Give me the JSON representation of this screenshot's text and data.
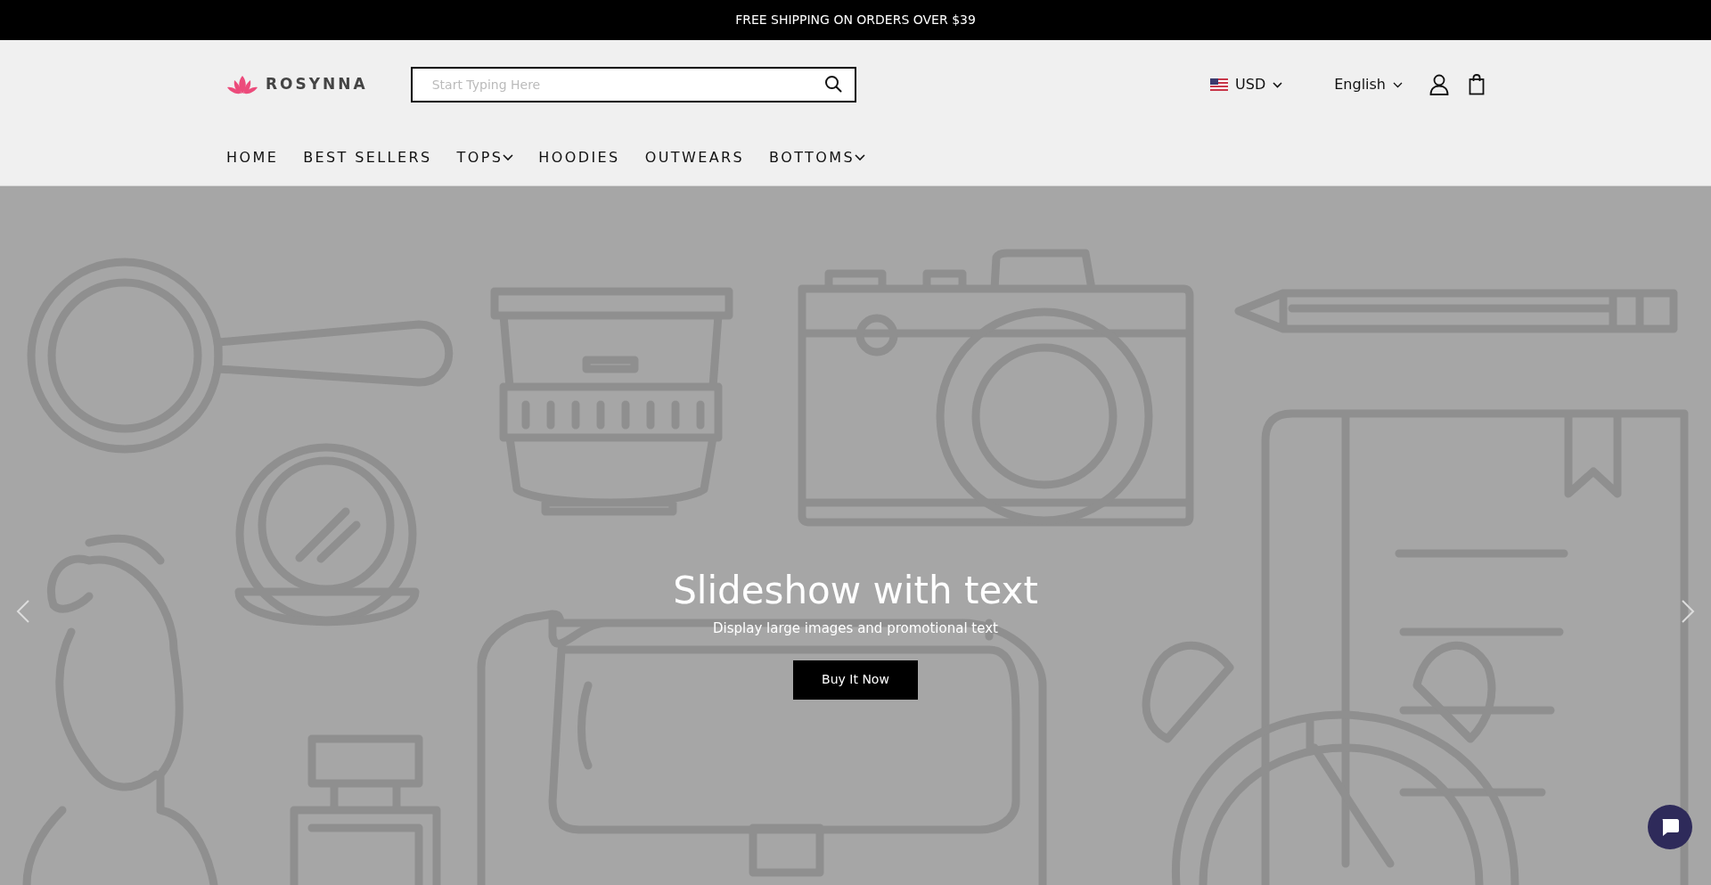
{
  "announcement": "FREE SHIPPING ON ORDERS OVER $39",
  "logo": {
    "text": "ROSYNNA"
  },
  "search": {
    "placeholder": "Start Typing Here"
  },
  "currency": {
    "code": "USD"
  },
  "language": {
    "label": "English"
  },
  "nav": [
    {
      "label": "HOME",
      "has_dropdown": false
    },
    {
      "label": "BEST SELLERS",
      "has_dropdown": false
    },
    {
      "label": "TOPS",
      "has_dropdown": true
    },
    {
      "label": "HOODIES",
      "has_dropdown": false
    },
    {
      "label": "OUTWEARS",
      "has_dropdown": false
    },
    {
      "label": "BOTTOMS",
      "has_dropdown": true
    }
  ],
  "hero": {
    "title": "Slideshow with text",
    "subtitle": "Display large images and promotional text",
    "button": "Buy It Now"
  }
}
